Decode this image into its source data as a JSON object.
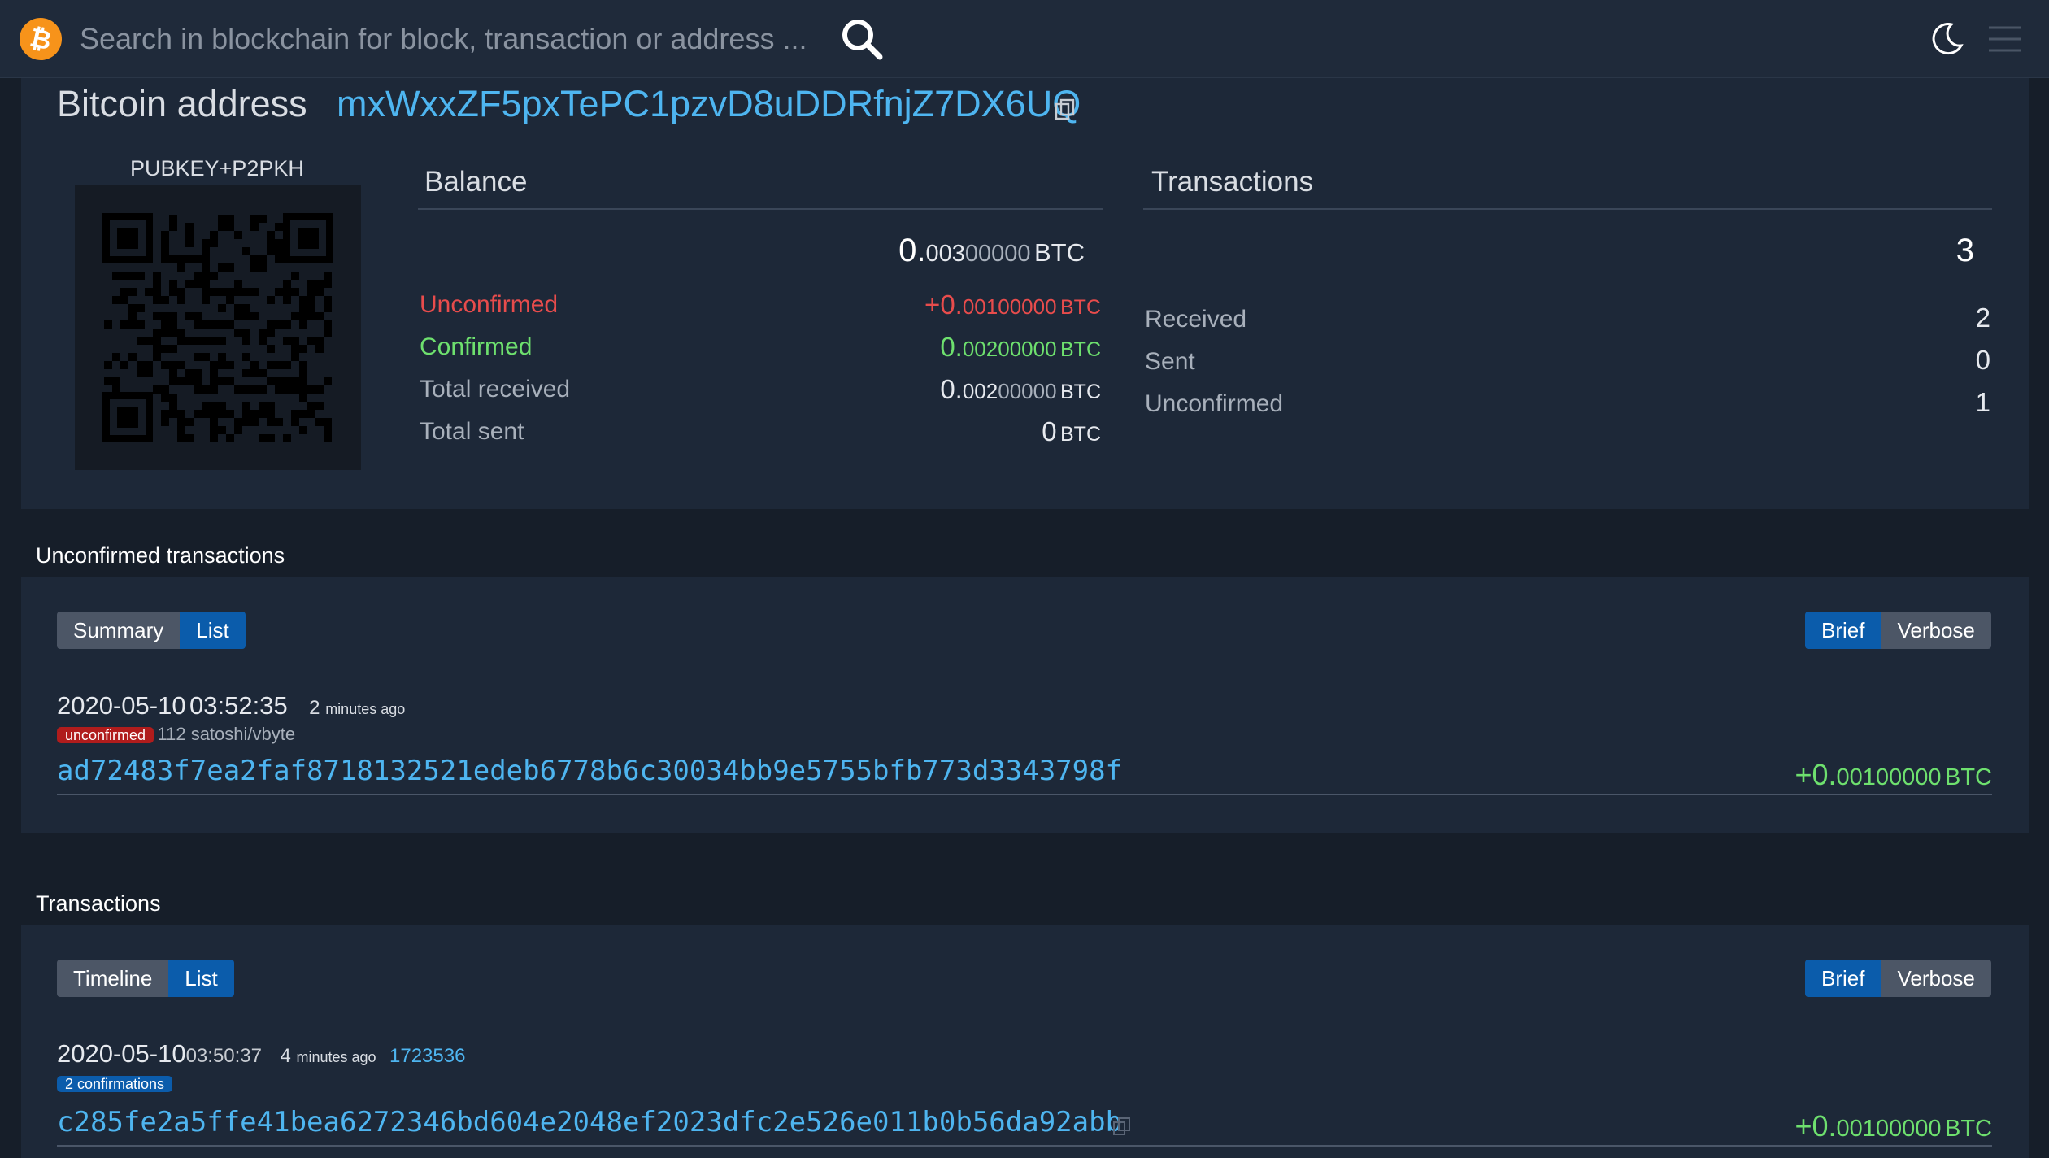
{
  "search": {
    "placeholder": "Search in blockchain for block, transaction or address ..."
  },
  "address": {
    "label": "Bitcoin address",
    "value": "mxWxxZF5pxTePC1pzvD8uDDRfnjZ7DX6UQ",
    "script_type": "PUBKEY+P2PKH"
  },
  "balance": {
    "heading": "Balance",
    "total": {
      "int": "0.",
      "dec_hi": "003",
      "dec_lo": "00000",
      "unit": "BTC"
    },
    "rows": [
      {
        "label": "Unconfirmed",
        "int": "+0.",
        "dec_hi": "001",
        "dec_lo": "00000",
        "unit": "BTC"
      },
      {
        "label": "Confirmed",
        "int": "0.",
        "dec_hi": "002",
        "dec_lo": "00000",
        "unit": "BTC"
      },
      {
        "label": "Total received",
        "int": "0.",
        "dec_hi": "002",
        "dec_lo": "00000",
        "unit": "BTC"
      },
      {
        "label": "Total sent",
        "int": "0",
        "dec_hi": "",
        "dec_lo": "",
        "unit": "BTC"
      }
    ]
  },
  "tx_stats": {
    "heading": "Transactions",
    "total": "3",
    "rows": [
      {
        "label": "Received",
        "value": "2"
      },
      {
        "label": "Sent",
        "value": "0"
      },
      {
        "label": "Unconfirmed",
        "value": "1"
      }
    ]
  },
  "unconfirmed": {
    "title": "Unconfirmed transactions",
    "view_tabs": [
      "Summary",
      "List"
    ],
    "detail_tabs": [
      "Brief",
      "Verbose"
    ],
    "tx": {
      "date": "2020-05-10",
      "time": "03:52:35",
      "ago_num": "2",
      "ago_text": "minutes ago",
      "badge": "unconfirmed",
      "fee": "112 satoshi/vbyte",
      "txid": "ad72483f7ea2faf8718132521edeb6778b6c30034bb9e5755bfb773d3343798f",
      "amount_int": "+0.",
      "amount_dec": "00100000",
      "unit": "BTC"
    }
  },
  "transactions": {
    "title": "Transactions",
    "view_tabs": [
      "Timeline",
      "List"
    ],
    "detail_tabs": [
      "Brief",
      "Verbose"
    ],
    "tx": {
      "date": "2020-05-10",
      "time": "03:50:37",
      "ago_num": "4",
      "ago_text": "minutes ago",
      "block": "1723536",
      "badge": "2 confirmations",
      "txid": "c285fe2a5ffe41bea6272346bd604e2048ef2023dfc2e526e011b0b56da92abb",
      "amount_int": "+0.",
      "amount_dec": "00100000",
      "unit": "BTC"
    }
  },
  "colors": {
    "accent_blue": "#4eb5f0",
    "button_active": "#0b5cab",
    "unconfirmed_red": "#e84c4c",
    "confirmed_green": "#6ee06e",
    "bitcoin_orange": "#f7931a"
  },
  "icons": [
    "bitcoin-logo-icon",
    "search-icon",
    "moon-icon",
    "hamburger-menu-icon",
    "copy-icon",
    "qr-code"
  ]
}
